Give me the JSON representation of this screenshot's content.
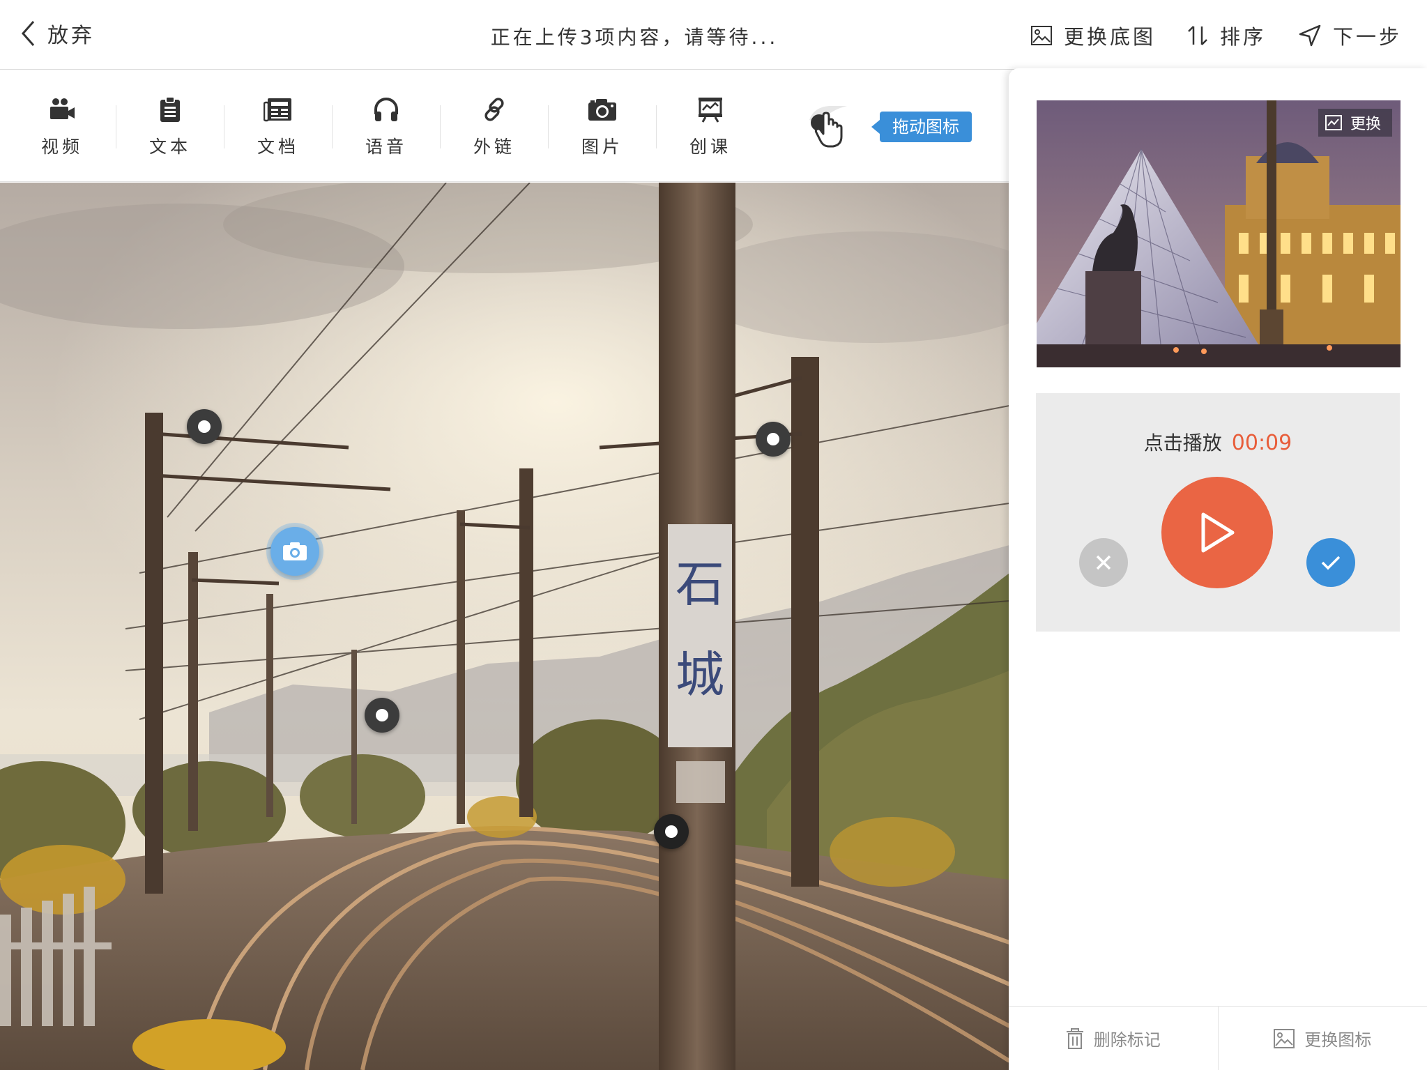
{
  "header": {
    "back_label": "放弃",
    "upload_status": "正在上传3项内容，请等待...",
    "actions": {
      "replace_background": "更换底图",
      "sort": "排序",
      "next_step": "下一步"
    }
  },
  "toolbar": {
    "tools": [
      {
        "label": "视频",
        "icon": "video-camera-icon"
      },
      {
        "label": "文本",
        "icon": "clipboard-icon"
      },
      {
        "label": "文档",
        "icon": "newspaper-icon"
      },
      {
        "label": "语音",
        "icon": "headphones-icon"
      },
      {
        "label": "外链",
        "icon": "link-icon"
      },
      {
        "label": "图片",
        "icon": "camera-icon"
      },
      {
        "label": "创课",
        "icon": "presentation-icon"
      }
    ],
    "drag_hint": "拖动图标"
  },
  "panel": {
    "replace_label": "更换",
    "play_label": "点击播放",
    "duration": "00:09",
    "footer": {
      "delete_marker": "删除标记",
      "replace_icon": "更换图标"
    }
  },
  "colors": {
    "accent_blue": "#3a8fd9",
    "play_orange": "#ea6544",
    "duration_orange": "#e85d3a",
    "cancel_gray": "#c5c5c5"
  }
}
